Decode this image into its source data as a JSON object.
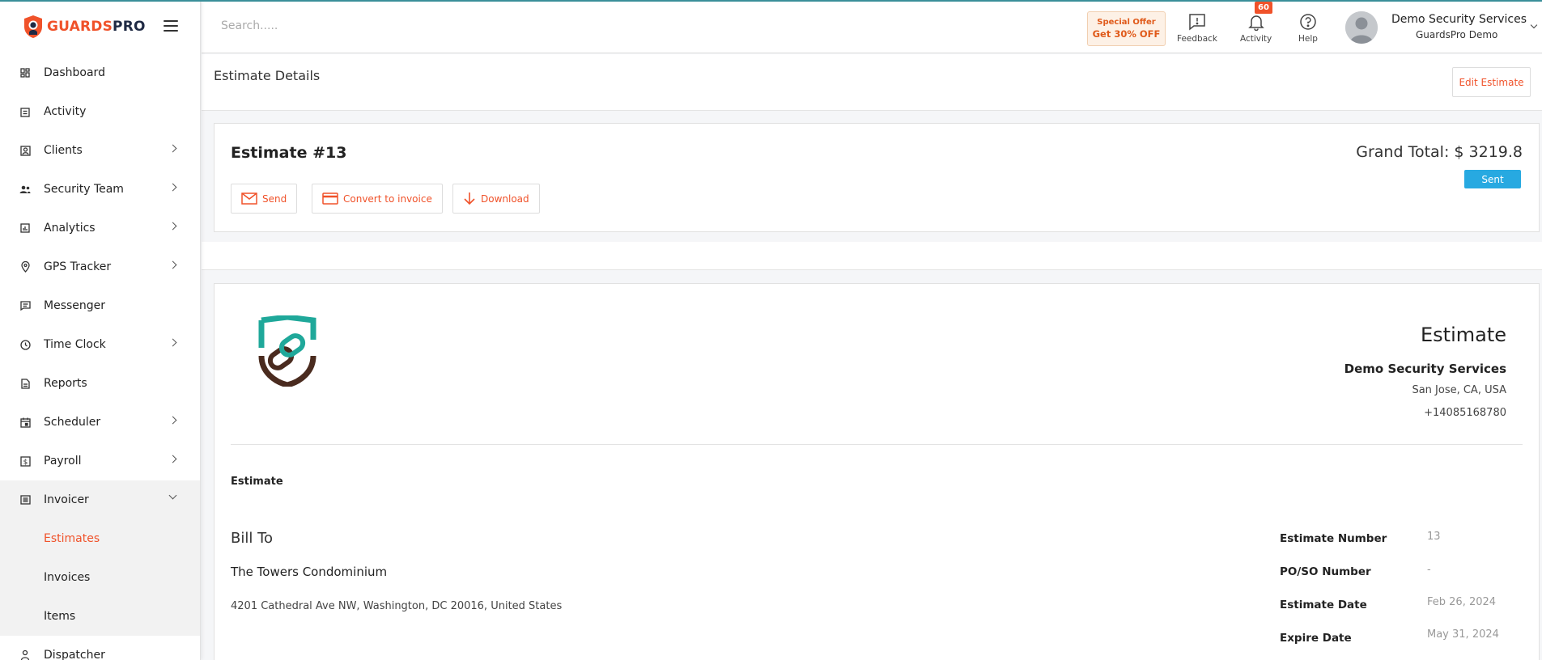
{
  "brand": {
    "part1": "GUARDS",
    "part2": "PRO"
  },
  "sidebar": {
    "items": [
      {
        "label": "Dashboard",
        "icon": "dashboard-icon"
      },
      {
        "label": "Activity",
        "icon": "clipboard-icon"
      },
      {
        "label": "Clients",
        "icon": "clients-icon"
      },
      {
        "label": "Security Team",
        "icon": "team-icon"
      },
      {
        "label": "Analytics",
        "icon": "analytics-icon"
      },
      {
        "label": "GPS Tracker",
        "icon": "location-pin-icon"
      },
      {
        "label": "Messenger",
        "icon": "message-icon"
      },
      {
        "label": "Time Clock",
        "icon": "clock-icon"
      },
      {
        "label": "Reports",
        "icon": "report-icon"
      },
      {
        "label": "Scheduler",
        "icon": "calendar-icon"
      },
      {
        "label": "Payroll",
        "icon": "payroll-icon"
      },
      {
        "label": "Invoicer",
        "icon": "invoice-icon"
      },
      {
        "label": "Dispatcher",
        "icon": "dispatcher-icon"
      }
    ],
    "invoicer_sub": [
      {
        "label": "Estimates"
      },
      {
        "label": "Invoices"
      },
      {
        "label": "Items"
      }
    ]
  },
  "header": {
    "search_placeholder": "Search.....",
    "offer_line1": "Special Offer",
    "offer_line2": "Get 30% OFF",
    "feedback": "Feedback",
    "activity": "Activity",
    "activity_count": "60",
    "help": "Help",
    "user_name": "Demo Security Services",
    "user_sub": "GuardsPro Demo"
  },
  "page": {
    "title": "Estimate Details",
    "edit_button": "Edit Estimate"
  },
  "estimate": {
    "heading": "Estimate #13",
    "send": "Send",
    "convert": "Convert to invoice",
    "download": "Download",
    "grand_total": "Grand Total: $ 3219.8",
    "status": "Sent"
  },
  "document": {
    "heading": "Estimate",
    "company": "Demo Security Services",
    "address": "San Jose, CA, USA",
    "phone": "+14085168780",
    "label": "Estimate",
    "bill_to": "Bill To",
    "client": "The Towers Condominium",
    "client_address": "4201 Cathedral Ave NW, Washington, DC 20016, United States",
    "meta": [
      {
        "key": "Estimate Number",
        "value": "13"
      },
      {
        "key": "PO/SO Number",
        "value": "-"
      },
      {
        "key": "Estimate Date",
        "value": "Feb 26, 2024"
      },
      {
        "key": "Expire Date",
        "value": "May 31, 2024"
      }
    ]
  },
  "colors": {
    "accent": "#f0522a",
    "status": "#27a9e1",
    "brand_dark": "#1f2a44"
  }
}
